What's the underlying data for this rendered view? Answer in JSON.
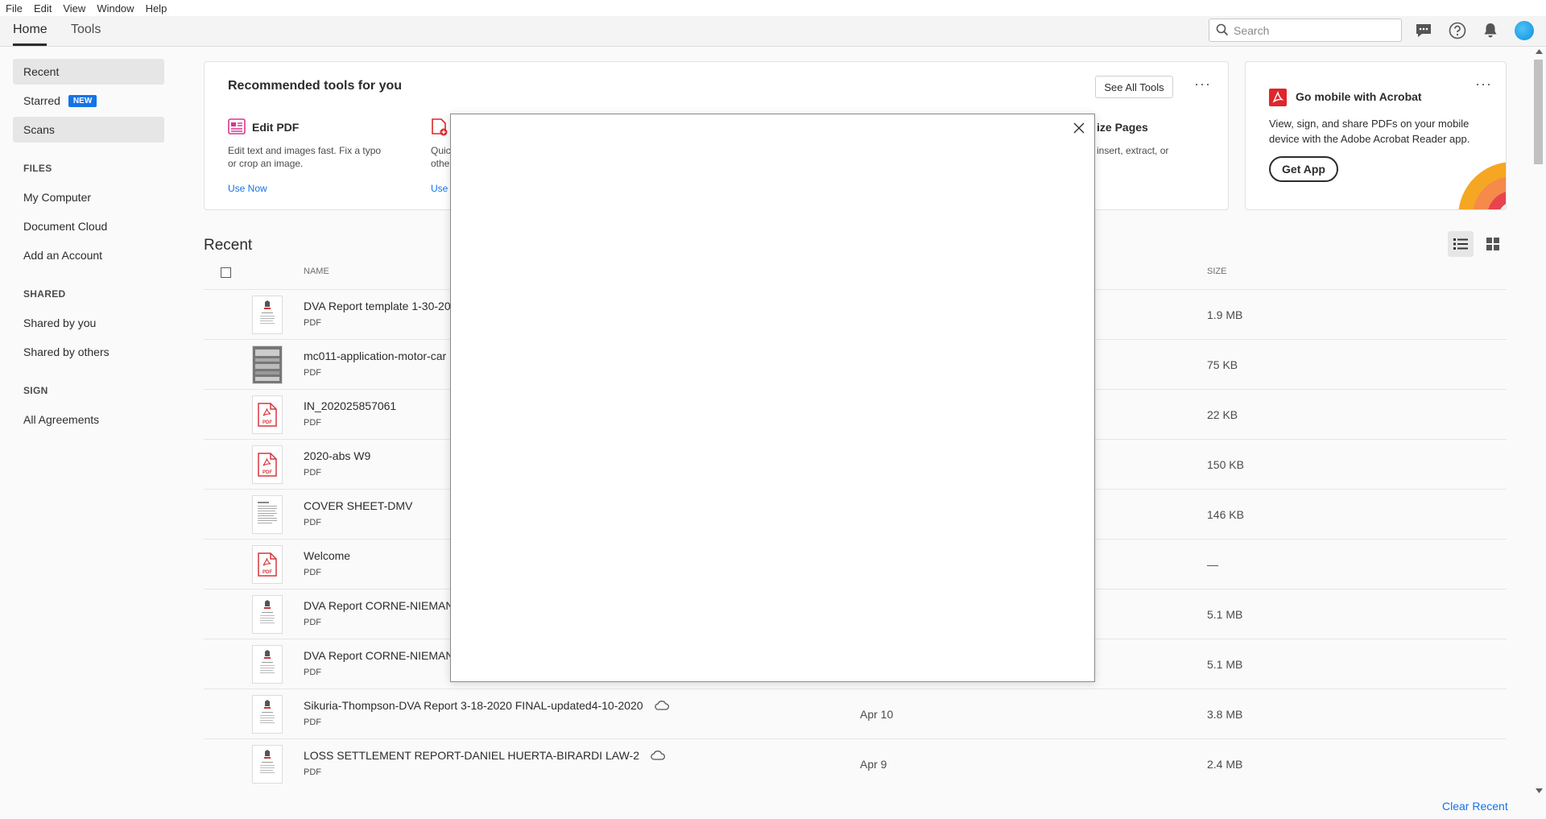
{
  "menubar": [
    "File",
    "Edit",
    "View",
    "Window",
    "Help"
  ],
  "tabs": {
    "home": "Home",
    "tools": "Tools"
  },
  "search": {
    "placeholder": "Search"
  },
  "sidebar": {
    "recent": "Recent",
    "starred": "Starred",
    "starred_badge": "NEW",
    "scans": "Scans",
    "files_head": "FILES",
    "my_computer": "My Computer",
    "document_cloud": "Document Cloud",
    "add_account": "Add an Account",
    "shared_head": "SHARED",
    "shared_by_you": "Shared by you",
    "shared_by_others": "Shared by others",
    "sign_head": "SIGN",
    "all_agreements": "All Agreements"
  },
  "tools_card": {
    "title": "Recommended tools for you",
    "see_all": "See All Tools",
    "more": "···",
    "tool1": {
      "name": "Edit PDF",
      "desc1": "Edit text and images fast. Fix a typo",
      "desc2": "or crop an image.",
      "link": "Use Now"
    },
    "tool2": {
      "desc1": "Quic",
      "desc2": "othe",
      "link": "Use N"
    },
    "tool3": {
      "name": "ize Pages",
      "desc1": "insert, extract, or"
    }
  },
  "mobile_card": {
    "title": "Go mobile with Acrobat",
    "more": "···",
    "desc1": "View, sign, and share PDFs on your mobile",
    "desc2": "device with the Adobe Acrobat Reader app.",
    "button": "Get App"
  },
  "recent": {
    "title": "Recent",
    "col_name": "NAME",
    "col_size": "SIZE",
    "clear": "Clear Recent",
    "files": [
      {
        "name": "DVA Report template 1-30-20",
        "type": "PDF",
        "date": "",
        "size": "1.9 MB",
        "thumb": "doc-logo"
      },
      {
        "name": "mc011-application-motor-car",
        "type": "PDF",
        "date": "",
        "size": "75 KB",
        "thumb": "doc-scan"
      },
      {
        "name": "IN_202025857061",
        "type": "PDF",
        "date": "",
        "size": "22 KB",
        "thumb": "pdf-icon"
      },
      {
        "name": "2020-abs W9",
        "type": "PDF",
        "date": "",
        "size": "150 KB",
        "thumb": "pdf-icon"
      },
      {
        "name": "COVER SHEET-DMV",
        "type": "PDF",
        "date": "",
        "size": "146 KB",
        "thumb": "doc-text"
      },
      {
        "name": "Welcome",
        "type": "PDF",
        "date": "",
        "size": "—",
        "thumb": "pdf-icon"
      },
      {
        "name": "DVA Report CORNE-NIEMANI",
        "type": "PDF",
        "date": "",
        "size": "5.1 MB",
        "thumb": "doc-logo"
      },
      {
        "name": "DVA Report CORNE-NIEMANI",
        "type": "PDF",
        "date": "",
        "size": "5.1 MB",
        "thumb": "doc-logo"
      },
      {
        "name": "Sikuria-Thompson-DVA Report 3-18-2020 FINAL-updated4-10-2020",
        "type": "PDF",
        "date": "Apr 10",
        "size": "3.8 MB",
        "thumb": "doc-logo",
        "cloud": true
      },
      {
        "name": "LOSS SETTLEMENT REPORT-DANIEL HUERTA-BIRARDI LAW-2",
        "type": "PDF",
        "date": "Apr 9",
        "size": "2.4 MB",
        "thumb": "doc-logo",
        "cloud": true
      }
    ]
  },
  "colors": {
    "accent": "#1473e6",
    "pdf_red": "#d7373f",
    "adobe_red": "#e0252b"
  },
  "icons": [
    "search-icon",
    "chat-icon",
    "help-icon",
    "bell-icon",
    "list-view-icon",
    "grid-view-icon",
    "close-icon",
    "cloud-icon",
    "pdf-file-icon",
    "edit-pdf-icon",
    "acrobat-logo-icon"
  ]
}
